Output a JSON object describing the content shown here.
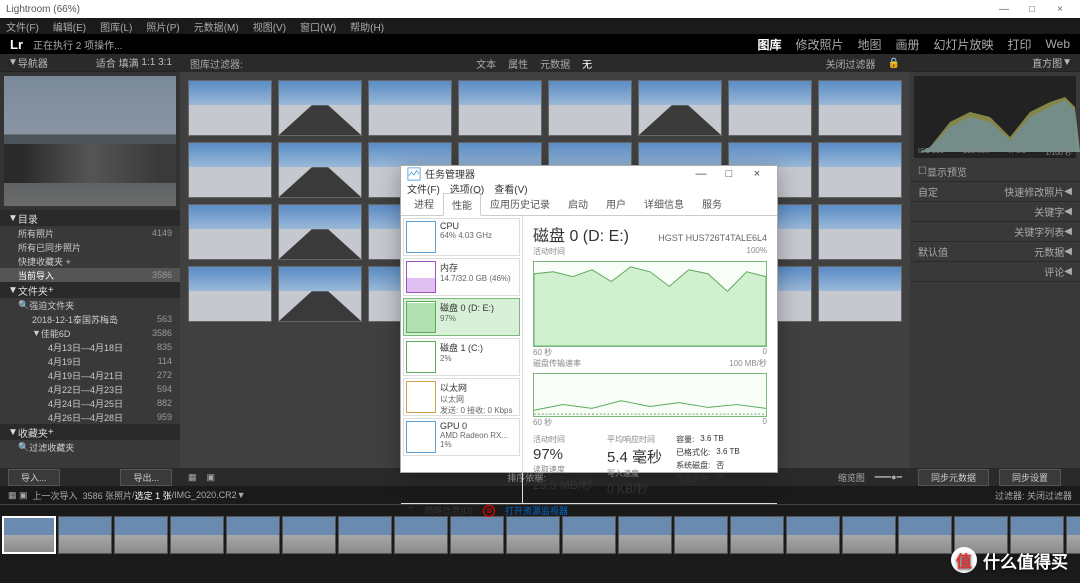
{
  "window": {
    "title": "Lightroom (66%)",
    "min": "—",
    "max": "□",
    "close": "×"
  },
  "menubar": [
    "文件(F)",
    "编辑(E)",
    "图库(L)",
    "照片(P)",
    "元数据(M)",
    "视图(V)",
    "窗口(W)",
    "帮助(H)"
  ],
  "header": {
    "logo": "Lr",
    "status": "正在执行 2 项操作...",
    "nav": [
      "图库",
      "修改照片",
      "地图",
      "画册",
      "幻灯片放映",
      "打印",
      "Web"
    ],
    "active_nav": "图库"
  },
  "left_panel": {
    "navigator": {
      "title": "导航器",
      "fit": "适合",
      "fill": "填满",
      "ratio": "1:1",
      "zoom": "3:1"
    },
    "catalog": {
      "title": "目录",
      "items": [
        {
          "label": "所有照片",
          "count": "4149"
        },
        {
          "label": "所有已同步照片",
          "count": ""
        },
        {
          "label": "快捷收藏夹 +",
          "count": ""
        },
        {
          "label": "当前导入",
          "count": "3586",
          "selected": true
        }
      ]
    },
    "folders": {
      "title": "文件夹",
      "add": "强迫文件夹",
      "tree": [
        {
          "label": "2018-12-1泰国苏梅岛",
          "count": "563",
          "indent": 0
        },
        {
          "label": "佳能6D",
          "count": "3586",
          "indent": 0
        },
        {
          "label": "4月13日—4月18日",
          "count": "835",
          "indent": 1
        },
        {
          "label": "4月19日",
          "count": "114",
          "indent": 1
        },
        {
          "label": "4月19日—4月21日",
          "count": "272",
          "indent": 1
        },
        {
          "label": "4月22日—4月23日",
          "count": "594",
          "indent": 1
        },
        {
          "label": "4月24日—4月25日",
          "count": "882",
          "indent": 1
        },
        {
          "label": "4月26日—4月28日",
          "count": "959",
          "indent": 1
        }
      ]
    },
    "collections": {
      "title": "收藏夹",
      "filter": "过滤收藏夹"
    },
    "import_btn": "导入...",
    "export_btn": "导出..."
  },
  "center": {
    "filter_title": "图库过滤器:",
    "filters": [
      "文本",
      "属性",
      "元数据",
      "无"
    ],
    "close_filter": "关闭过滤器",
    "sort_label": "排序依据:",
    "thumb_label": "缩览图"
  },
  "right_panel": {
    "histogram_title": "直方图",
    "axis": [
      "ISO 500",
      "200 mm",
      "f / 5.6",
      "1/100 秒"
    ],
    "preview_cb": "显示预览",
    "quick_dev": {
      "save": "自定",
      "quick_btn": "快速修改照片"
    },
    "keywords": {
      "title": "关键字",
      "list": "关键字列表"
    },
    "metadata": {
      "default": "默认值",
      "title": "元数据"
    },
    "comments": "评论",
    "sync_meta": "同步元数据",
    "sync_settings": "同步设置"
  },
  "statusbar": {
    "prev_import": "上一次导入",
    "count": "3586 张照片",
    "selected": "选定 1 张",
    "filename": "IMG_2020.CR2",
    "filter_label": "过滤器:",
    "filter_off": "关闭过滤器"
  },
  "taskman": {
    "title": "任务管理器",
    "menu": [
      "文件(F)",
      "选项(O)",
      "查看(V)"
    ],
    "tabs": [
      "进程",
      "性能",
      "应用历史记录",
      "启动",
      "用户",
      "详细信息",
      "服务"
    ],
    "active_tab": "性能",
    "items": [
      {
        "name": "CPU",
        "val": "64% 4.03 GHz",
        "type": "cpu"
      },
      {
        "name": "内存",
        "val": "14.7/32.0 GB (46%)",
        "type": "mem"
      },
      {
        "name": "磁盘 0 (D: E:)",
        "val": "97%",
        "type": "disk",
        "selected": true
      },
      {
        "name": "磁盘 1 (C:)",
        "val": "2%",
        "type": "disk2"
      },
      {
        "name": "以太网",
        "val": "以太网",
        "val2": "发送: 0 接收: 0 Kbps",
        "type": "eth"
      },
      {
        "name": "GPU 0",
        "val": "AMD Radeon RX...",
        "val2": "1%",
        "type": "gpu"
      }
    ],
    "detail": {
      "title": "磁盘 0 (D: E:)",
      "model": "HGST HUS726T4TALE6L4",
      "graph1_label": "活动时间",
      "graph1_max": "100%",
      "graph1_x": "60 秒",
      "graph2_label": "磁盘传输速率",
      "graph2_max": "100 MB/秒",
      "graph2_x": "60 秒",
      "stats": {
        "active_lbl": "活动时间",
        "active": "97%",
        "resp_lbl": "平均响应时间",
        "resp": "5.4 毫秒",
        "read_lbl": "读取速度",
        "read": "25.5 MB/秒",
        "write_lbl": "写入速度",
        "write": "0 KB/秒",
        "cap_lbl": "容量:",
        "cap": "3.6 TB",
        "fmt_lbl": "已格式化:",
        "fmt": "3.6 TB",
        "sys_lbl": "系统磁盘:",
        "sys": "否",
        "page_lbl": "页面文件:",
        "page": "否"
      }
    },
    "footer": {
      "less": "简略信息(D)",
      "monitor": "打开资源监视器"
    }
  },
  "watermark": "什么值得买"
}
